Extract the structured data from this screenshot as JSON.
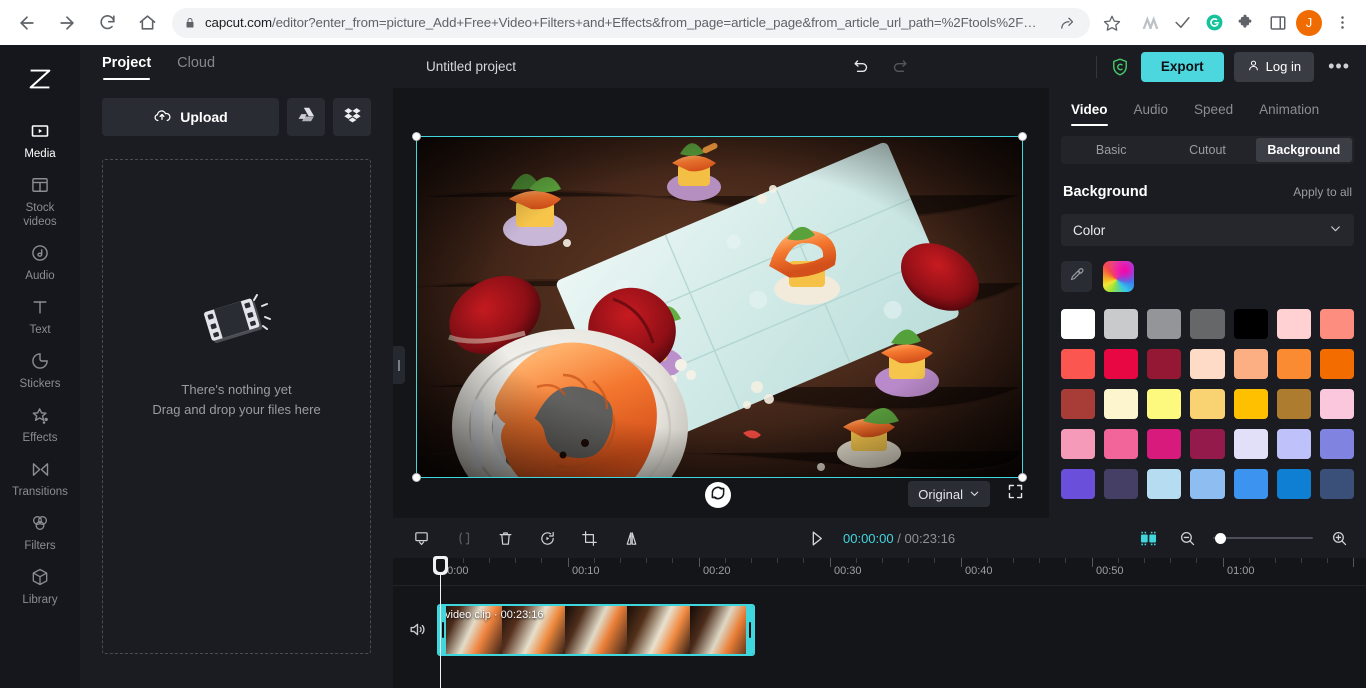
{
  "browser": {
    "url_host": "capcut.com",
    "url_rest": "/editor?enter_from=picture_Add+Free+Video+Filters+and+Effects&from_page=article_page&from_article_url_path=%2Ftools%2F…",
    "back_icon": "back-arrow-icon",
    "forward_icon": "forward-arrow-icon",
    "reload_icon": "reload-icon",
    "home_icon": "home-icon",
    "lock_icon": "lock-icon",
    "share_icon": "share-icon",
    "star_icon": "star-icon",
    "avatar_letter": "J"
  },
  "rail": {
    "logo": "capcut-logo-icon",
    "items": [
      {
        "label": "Media",
        "icon": "media-icon",
        "active": true
      },
      {
        "label": "Stock\nvideos",
        "icon": "stock-videos-icon",
        "active": false
      },
      {
        "label": "Audio",
        "icon": "audio-icon",
        "active": false
      },
      {
        "label": "Text",
        "icon": "text-icon",
        "active": false
      },
      {
        "label": "Stickers",
        "icon": "stickers-icon",
        "active": false
      },
      {
        "label": "Effects",
        "icon": "effects-icon",
        "active": false
      },
      {
        "label": "Transitions",
        "icon": "transitions-icon",
        "active": false
      },
      {
        "label": "Filters",
        "icon": "filters-icon",
        "active": false
      },
      {
        "label": "Library",
        "icon": "library-icon",
        "active": false
      }
    ]
  },
  "panel": {
    "tabs": [
      {
        "label": "Project",
        "active": true
      },
      {
        "label": "Cloud",
        "active": false
      }
    ],
    "upload_label": "Upload",
    "upload_icon": "cloud-upload-icon",
    "google_drive_icon": "google-drive-icon",
    "dropbox_icon": "dropbox-icon",
    "empty_title": "There's nothing yet",
    "empty_subtitle": "Drag and drop your files here",
    "empty_icon": "film-strip-icon"
  },
  "header": {
    "project_name": "Untitled project",
    "undo_icon": "undo-icon",
    "redo_icon": "redo-icon",
    "shield_icon": "copyright-shield-icon",
    "export_label": "Export",
    "login_label": "Log in",
    "login_icon": "user-icon",
    "more_label": "•••"
  },
  "preview": {
    "reset_icon": "reset-rotate-icon",
    "ratio_label": "Original",
    "ratio_chevron": "chevron-down-icon",
    "fullscreen_icon": "fullscreen-icon",
    "collapse_icon": "collapse-panel-handle"
  },
  "props": {
    "tabs": [
      {
        "label": "Video",
        "active": true
      },
      {
        "label": "Audio",
        "active": false
      },
      {
        "label": "Speed",
        "active": false
      },
      {
        "label": "Animation",
        "active": false
      }
    ],
    "segments": [
      {
        "label": "Basic",
        "active": false
      },
      {
        "label": "Cutout",
        "active": false
      },
      {
        "label": "Background",
        "active": true
      }
    ],
    "section_title": "Background",
    "apply_all_label": "Apply to all",
    "dropdown_value": "Color",
    "dropdown_chevron": "chevron-down-icon",
    "eyedropper_icon": "eyedropper-icon",
    "rainbow_icon": "color-picker-gradient-icon",
    "swatches": [
      "#ffffff",
      "#c9cacc",
      "#949599",
      "#666769",
      "#000000",
      "#ffd1d2",
      "#fd8d7f",
      "#fb5650",
      "#e80742",
      "#941834",
      "#fddbc7",
      "#fcaf82",
      "#fb8b33",
      "#f36c00",
      "#a83c36",
      "#fcf5cd",
      "#fdf87e",
      "#f9d271",
      "#ffc000",
      "#ad7c2f",
      "#fac7dd",
      "#f69ab9",
      "#f1659a",
      "#d91a7d",
      "#941a4b",
      "#e1e0f8",
      "#bfc2fa",
      "#8183e0",
      "#6a4fdb",
      "#453f66",
      "#b5dcf0",
      "#8ebdf2",
      "#3d93f0",
      "#0f7fd4",
      "#3a5078"
    ]
  },
  "timeline": {
    "tools": [
      {
        "icon": "split-screen-icon",
        "name": "split-icon",
        "dim": false
      },
      {
        "icon": "trim-icon",
        "name": "trim-icon",
        "dim": true
      },
      {
        "icon": "delete-icon",
        "name": "delete-icon",
        "dim": false
      },
      {
        "icon": "freeze-icon",
        "name": "freeze-frame-icon",
        "dim": false
      },
      {
        "icon": "crop-icon",
        "name": "crop-icon",
        "dim": false
      },
      {
        "icon": "mirror-icon",
        "name": "mirror-icon",
        "dim": false
      }
    ],
    "play_icon": "play-icon",
    "current_time": "00:00:00",
    "separator": "/",
    "total_time": "00:23:16",
    "markers_icon": "markers-icon",
    "zoom_out_icon": "zoom-out-icon",
    "zoom_in_icon": "zoom-in-icon",
    "zoom_value": 2,
    "ruler_labels": [
      "00:00",
      "00:10",
      "00:20",
      "00:30",
      "00:40",
      "00:50",
      "01:00"
    ],
    "audio_icon": "volume-icon",
    "clip": {
      "name": "video clip",
      "separator": "·",
      "duration": "00:23:16"
    }
  },
  "colors": {
    "accent": "#3fd6dd",
    "export_bg": "#4cd6de",
    "panel_bg": "#1b1c21",
    "rail_bg": "#16171c",
    "timeline_bg": "#141519"
  }
}
